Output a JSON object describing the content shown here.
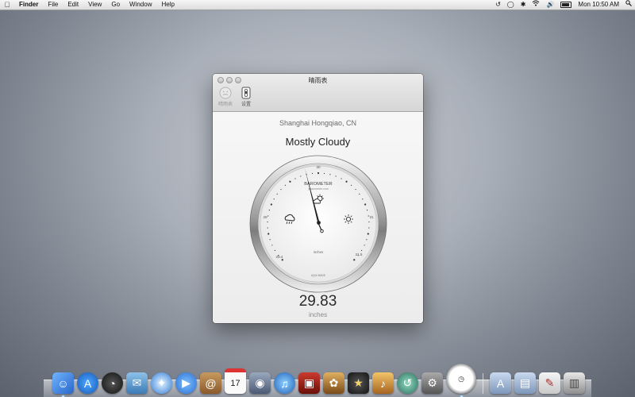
{
  "menubar": {
    "apple": "",
    "items": [
      "Finder",
      "File",
      "Edit",
      "View",
      "Go",
      "Window",
      "Help"
    ],
    "clock": "Mon 10:50 AM"
  },
  "window": {
    "title": "晴雨表",
    "toolbar": [
      {
        "label": "晴雨表",
        "icon": "barometer-face-icon"
      },
      {
        "label": "设置",
        "icon": "settings-switch-icon"
      }
    ],
    "location": "Shanghai Hongqiao, CN",
    "condition": "Mostly Cloudy",
    "gauge": {
      "brand": "BAROMETER",
      "brand_sub": "ybarometer.com",
      "unit_label": "inches",
      "bottom_label": "AQUI MADE",
      "scale_labels": [
        "28.4",
        "29",
        "30",
        "31",
        "31.5"
      ],
      "icons": [
        "rain-cloud-icon",
        "partly-cloudy-icon",
        "sun-icon"
      ]
    },
    "reading": "29.83",
    "reading_unit": "inches"
  },
  "dock": {
    "items": [
      "finder-icon",
      "app-store-icon",
      "dashboard-icon",
      "mail-stamp-icon",
      "safari-icon",
      "facetime-icon",
      "address-book-icon",
      "ical-icon",
      "photo-booth-icon",
      "itunes-icon",
      "dvd-player-icon",
      "iphoto-icon",
      "imovie-icon",
      "garageband-icon",
      "time-machine-icon",
      "system-preferences-icon",
      "barometer-app-icon",
      "applications-folder-icon",
      "documents-folder-icon",
      "preview-icon",
      "trash-icon"
    ],
    "ical_day": "17"
  }
}
